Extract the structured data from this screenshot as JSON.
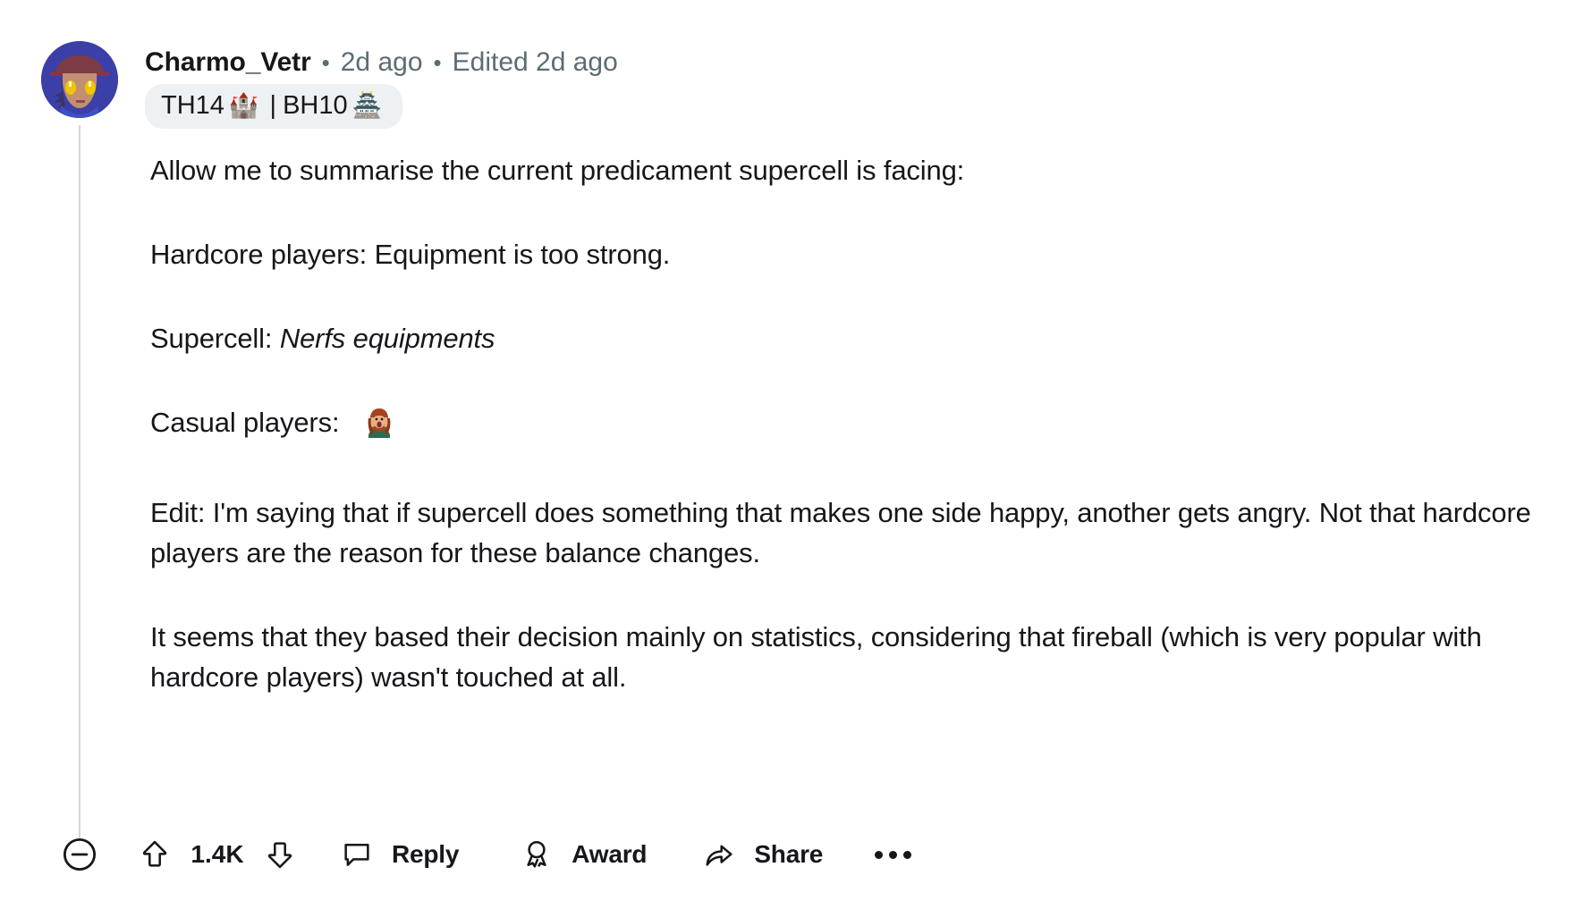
{
  "comment": {
    "author": "Charmo_Vetr",
    "separator": "•",
    "posted_time": "2d ago",
    "edited_time": "Edited 2d ago",
    "flair": {
      "th_label": "TH14",
      "th_emoji": "🏰",
      "divider": "|",
      "bh_label": "BH10",
      "bh_emoji": "🏯"
    },
    "avatar_name": "anime-character-avatar",
    "paragraphs": [
      {
        "id": "p1",
        "text": "Allow me to summarise the current predicament supercell is facing:"
      },
      {
        "id": "p2",
        "text": "Hardcore players: Equipment is too strong."
      },
      {
        "id": "p3",
        "prefix": "Supercell: ",
        "italic": "Nerfs equipments"
      },
      {
        "id": "p4",
        "prefix": "Casual players: ",
        "emoji": "🤦‍♀️"
      },
      {
        "id": "p5",
        "text": "Edit: I'm saying that if supercell does something that makes one side happy, another gets angry. Not that hardcore players are the reason for these balance changes."
      },
      {
        "id": "p6",
        "text": "It seems that they based their decision mainly on statistics, considering that fireball (which is very popular with hardcore players) wasn't touched at all."
      }
    ]
  },
  "actions": {
    "collapse_icon": "minus-circle-icon",
    "upvote_icon": "upvote-arrow-icon",
    "vote_count": "1.4K",
    "downvote_icon": "downvote-arrow-icon",
    "reply_icon": "comment-bubble-icon",
    "reply_label": "Reply",
    "award_icon": "award-ribbon-icon",
    "award_label": "Award",
    "share_icon": "share-arrow-icon",
    "share_label": "Share",
    "more_label": "more-options-icon"
  },
  "colors": {
    "text": "#15171a",
    "muted": "#5c6c74",
    "flair_bg": "#eef1f3",
    "thread_line": "#d2d7da",
    "page_bg": "#ffffff"
  }
}
